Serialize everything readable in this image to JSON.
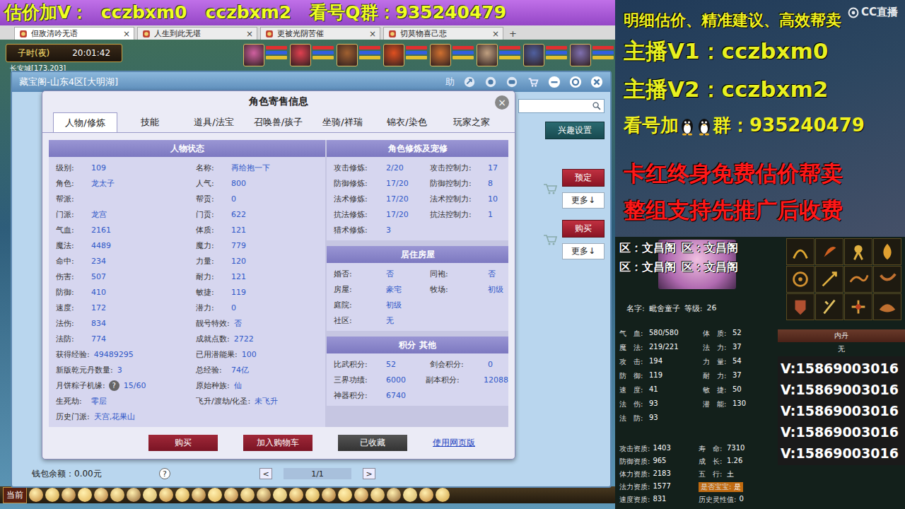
{
  "banner": "估价加V：  cczbxm0   cczbxm2   看号Q群：935240479",
  "browser_tabs": [
    {
      "label": "但敌清吟无语",
      "close": "×",
      "selected": true
    },
    {
      "label": "人生到此无堪",
      "close": "×",
      "selected": false
    },
    {
      "label": "更被光阴苦催",
      "close": "×",
      "selected": false
    },
    {
      "label": "切莫物喜己悲",
      "close": "×",
      "selected": false
    }
  ],
  "browser_add": "+",
  "hud": {
    "period": "子时(夜)",
    "clock": "20:01:42",
    "location": "长安城[173,203]"
  },
  "bottom_bar": {
    "channel": "当前"
  },
  "market": {
    "title": "藏宝阁-山东4区[大明湖]",
    "assist": "助",
    "interest": "兴趣设置",
    "listings": [
      {
        "action": "预定",
        "more": "更多↓"
      },
      {
        "action": "购买",
        "more": "更多↓"
      }
    ],
    "wallet": "钱包余额：0.00元",
    "help": "?",
    "prev": "<",
    "page": "1/1",
    "next": ">"
  },
  "dialog": {
    "title": "角色寄售信息",
    "close": "×",
    "tabs": [
      {
        "label": "人物/修炼",
        "selected": true
      },
      {
        "label": "技能",
        "selected": false
      },
      {
        "label": "道具/法宝",
        "selected": false
      },
      {
        "label": "召唤兽/孩子",
        "selected": false
      },
      {
        "label": "坐骑/祥瑞",
        "selected": false
      },
      {
        "label": "锦衣/染色",
        "selected": false
      },
      {
        "label": "玩家之家",
        "selected": false
      }
    ],
    "status": {
      "title": "人物状态",
      "rows": [
        [
          {
            "label": "级别:",
            "value": "109"
          },
          {
            "label": "名称:",
            "value": "再给抱一下"
          }
        ],
        [
          {
            "label": "角色:",
            "value": "龙太子"
          },
          {
            "label": "人气:",
            "value": "800"
          }
        ],
        [
          {
            "label": "帮派:"
          },
          {
            "label": "帮贡:",
            "value": "0"
          }
        ],
        [
          {
            "label": "门派:",
            "value": "龙宫"
          },
          {
            "label": "门贡:",
            "value": "622"
          }
        ],
        [
          {
            "label": "气血:",
            "value": "2161"
          },
          {
            "label": "体质:",
            "value": "121"
          }
        ],
        [
          {
            "label": "魔法:",
            "value": "4489"
          },
          {
            "label": "魔力:",
            "value": "779"
          }
        ],
        [
          {
            "label": "命中:",
            "value": "234"
          },
          {
            "label": "力量:",
            "value": "120"
          }
        ],
        [
          {
            "label": "伤害:",
            "value": "507"
          },
          {
            "label": "耐力:",
            "value": "121"
          }
        ],
        [
          {
            "label": "防御:",
            "value": "410"
          },
          {
            "label": "敏捷:",
            "value": "119"
          }
        ],
        [
          {
            "label": "速度:",
            "value": "172"
          },
          {
            "label": "潜力:",
            "value": "0"
          }
        ],
        [
          {
            "label": "法伤:",
            "value": "834"
          },
          {
            "label": "靓号特效:",
            "value": "否"
          }
        ],
        [
          {
            "label": "法防:",
            "value": "774"
          },
          {
            "label": "成就点数:",
            "value": "2722"
          }
        ],
        [
          {
            "label": "获得经验:",
            "value": "49489295"
          },
          {
            "label": "已用潜能果:",
            "value": "100"
          }
        ],
        [
          {
            "label": "新版乾元丹数量:",
            "value": "3"
          },
          {
            "label": "总经验:",
            "value": "74亿"
          }
        ],
        [
          {
            "label": "月饼粽子机缘:",
            "help": "?",
            "value": "15/60"
          },
          {
            "label": "原始种族:",
            "value": "仙"
          }
        ],
        [
          {
            "label": "生死劫:",
            "value": "零层"
          },
          {
            "label": "飞升/渡劫/化圣:",
            "value": "未飞升"
          }
        ],
        [
          {
            "label": "历史门派:",
            "value": "天宫,花果山"
          }
        ]
      ]
    },
    "cultivation": {
      "title": "角色修炼及宠修",
      "rows": [
        [
          {
            "label": "攻击修炼:",
            "value": "2/20"
          },
          {
            "label": "攻击控制力:",
            "value": "17"
          }
        ],
        [
          {
            "label": "防御修炼:",
            "value": "17/20"
          },
          {
            "label": "防御控制力:",
            "value": "8"
          }
        ],
        [
          {
            "label": "法术修炼:",
            "value": "17/20"
          },
          {
            "label": "法术控制力:",
            "value": "10"
          }
        ],
        [
          {
            "label": "抗法修炼:",
            "value": "17/20"
          },
          {
            "label": "抗法控制力:",
            "value": "1"
          }
        ],
        [
          {
            "label": "猎术修炼:",
            "value": "3"
          }
        ]
      ]
    },
    "house": {
      "title": "居住房屋",
      "rows": [
        [
          {
            "label": "婚否:",
            "value": "否"
          },
          {
            "label": "同袍:",
            "value": "否"
          }
        ],
        [
          {
            "label": "房屋:",
            "value": "豪宅"
          },
          {
            "label": "牧场:",
            "value": "初级"
          }
        ],
        [
          {
            "label": "庭院:",
            "value": "初级"
          }
        ],
        [
          {
            "label": "社区:",
            "value": "无"
          }
        ]
      ]
    },
    "points": {
      "title": "积分 其他",
      "rows": [
        [
          {
            "label": "比武积分:",
            "value": "52"
          },
          {
            "label": "剑会积分:",
            "value": "0"
          }
        ],
        [
          {
            "label": "三界功绩:",
            "value": "6000"
          },
          {
            "label": "副本积分:",
            "value": "12088"
          }
        ],
        [
          {
            "label": "神器积分:",
            "value": "6740"
          }
        ]
      ]
    },
    "buttons": [
      {
        "label": "购买",
        "kind": "primary"
      },
      {
        "label": "加入购物车",
        "kind": "primary"
      },
      {
        "label": "已收藏",
        "kind": "dark"
      },
      {
        "label": "使用网页版",
        "kind": "link"
      }
    ]
  },
  "watermark": "CC直播",
  "promo_lines": [
    {
      "text": "明细估价、精准建议、高效帮卖",
      "color": "#f0f020",
      "kind": "small"
    },
    {
      "text": "主播V1：cczbxm0",
      "color": "#e8f020",
      "kind": "large"
    },
    {
      "text": "主播V2：cczbxm2",
      "color": "#e8f020",
      "kind": "large"
    }
  ],
  "qq_line": {
    "before": "看号加",
    "after": "群：935240479"
  },
  "alert_lines": [
    {
      "text": "卡红终身免费估价帮卖",
      "color": "#ff1818"
    },
    {
      "text": "整组支持先推广后收费",
      "color": "#ff1818"
    }
  ],
  "pet": {
    "regions": [
      "区：文昌阁",
      "区：文昌阁",
      "区：文昌阁",
      "区：文昌阁"
    ],
    "name_label": "名字:",
    "name": "毗舍童子",
    "level_label": "等级:",
    "level": "26",
    "stats": [
      [
        {
          "label": "气　血:",
          "value": "580/580"
        },
        {
          "label": "体　质:",
          "value": "52"
        }
      ],
      [
        {
          "label": "魔　法:",
          "value": "219/221"
        },
        {
          "label": "法　力:",
          "value": "37"
        }
      ],
      [
        {
          "label": "攻　击:",
          "value": "194"
        },
        {
          "label": "力　量:",
          "value": "54"
        }
      ],
      [
        {
          "label": "防　御:",
          "value": "119"
        },
        {
          "label": "耐　力:",
          "value": "37"
        }
      ],
      [
        {
          "label": "速　度:",
          "value": "41"
        },
        {
          "label": "敏　捷:",
          "value": "50"
        }
      ],
      [
        {
          "label": "法　伤:",
          "value": "93"
        },
        {
          "label": "潜　能:",
          "value": "130"
        }
      ],
      [
        {
          "label": "法　防:",
          "value": "93"
        }
      ]
    ],
    "aptitudes": [
      [
        {
          "label": "攻击资质:",
          "value": "1403",
          "kind": "plain"
        },
        {
          "label": "寿　命:",
          "value": "7310",
          "kind": "plain"
        }
      ],
      [
        {
          "label": "防御资质:",
          "value": "965",
          "kind": "plain"
        },
        {
          "label": "成　长:",
          "value": "1.26",
          "kind": "plain"
        }
      ],
      [
        {
          "label": "体力资质:",
          "value": "2183",
          "kind": "plain"
        },
        {
          "label": "五　行:",
          "value": "土",
          "kind": "plain"
        }
      ],
      [
        {
          "label": "法力资质:",
          "value": "1577",
          "kind": "plain"
        },
        {
          "label": "是否宝宝:",
          "value": "是",
          "kind": "badge"
        }
      ],
      [
        {
          "label": "速度资质:",
          "value": "831",
          "kind": "plain"
        },
        {
          "label": "历史灵性值:",
          "value": "0",
          "kind": "plain"
        }
      ]
    ],
    "neidan": {
      "title": "内丹",
      "value": "无"
    },
    "contacts": [
      "V:15869003016",
      "V:15869003016",
      "V:15869003016",
      "V:15869003016",
      "V:15869003016"
    ]
  }
}
